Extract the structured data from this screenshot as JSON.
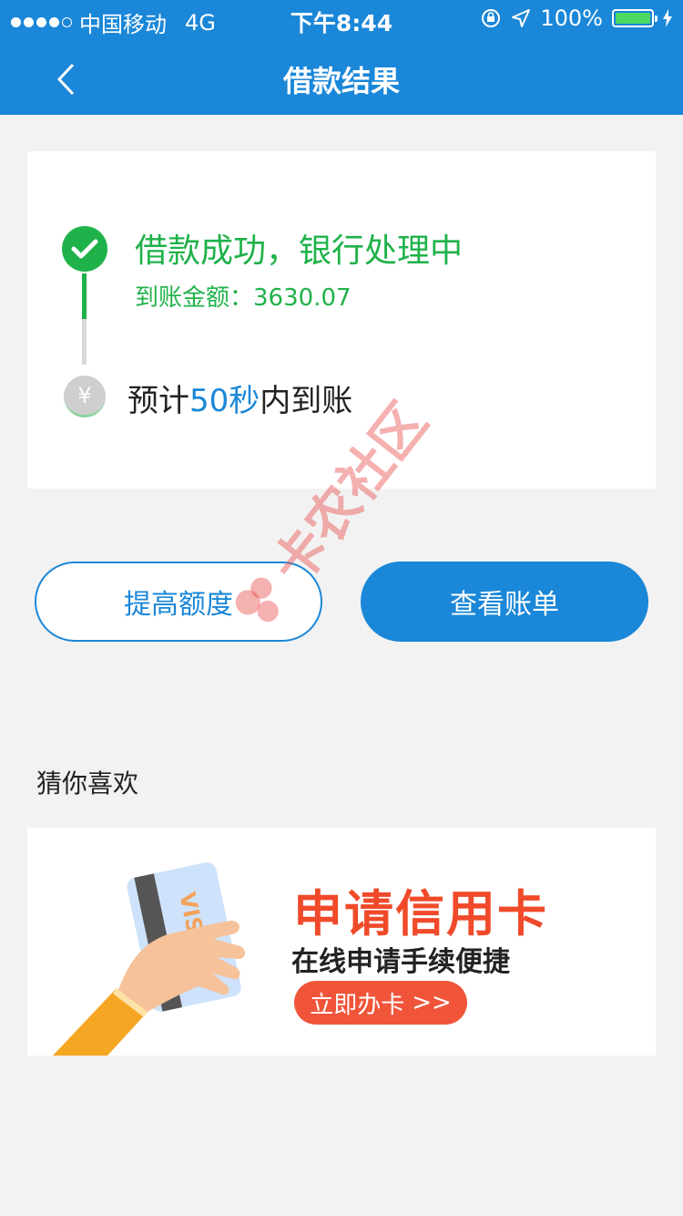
{
  "status_bar": {
    "carrier": "中国移动",
    "network": "4G",
    "time": "下午8:44",
    "battery": "100%",
    "battery_level": 1.0
  },
  "nav": {
    "title": "借款结果",
    "back_icon": "chevron-left-icon"
  },
  "result": {
    "success_title": "借款成功，银行处理中",
    "amount_label": "到账金额：",
    "amount_value": "3630.07",
    "eta_prefix": "预计",
    "eta_highlight": "50秒",
    "eta_suffix": "内到账",
    "yen_symbol": "¥"
  },
  "actions": {
    "raise_limit": "提高额度",
    "view_bill": "查看账单"
  },
  "watermark": {
    "text": "卡农社区"
  },
  "recommend": {
    "title": "猜你喜欢",
    "banner_title": "申请信用卡",
    "banner_subtitle": "在线申请手续便捷",
    "banner_button": "立即办卡",
    "banner_button_icon": ">>",
    "card_brand": "VISA"
  },
  "colors": {
    "primary": "#1a87d8",
    "success": "#1fb24a",
    "accent": "#f04a2a"
  }
}
